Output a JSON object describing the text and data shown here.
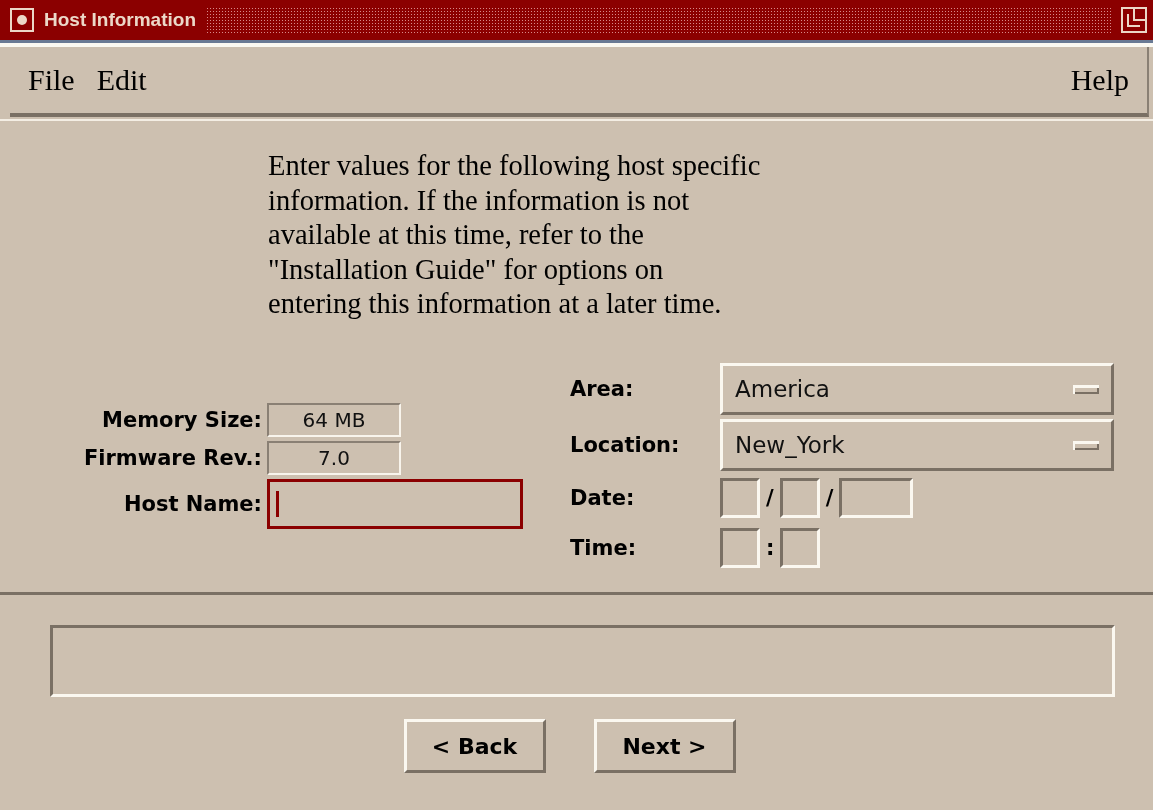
{
  "window": {
    "title": "Host Information"
  },
  "menu": [
    {
      "label": "File"
    },
    {
      "label": "Edit"
    },
    {
      "label": "Help"
    }
  ],
  "instructions": "Enter values for the following host specific\ninformation.  If the information is not\navailable at this time, refer to the\n\"Installation Guide\" for options on\nentering this information at a later time.",
  "host_fields": [
    {
      "label": "Memory Size:",
      "value": "64 MB",
      "kind": "readonly"
    },
    {
      "label": "Firmware Rev.:",
      "value": "7.0",
      "kind": "readonly"
    },
    {
      "label": "Host Name:",
      "kind": "input",
      "focused": true
    }
  ],
  "area": {
    "label": "Area:",
    "value": "America"
  },
  "location": {
    "label": "Location:",
    "value": "New_York"
  },
  "date": {
    "label": "Date:",
    "separators": [
      "/",
      "/"
    ]
  },
  "time": {
    "label": "Time:",
    "separators": [
      ":"
    ]
  },
  "buttons": [
    {
      "label": "< Back"
    },
    {
      "label": "Next >"
    }
  ]
}
